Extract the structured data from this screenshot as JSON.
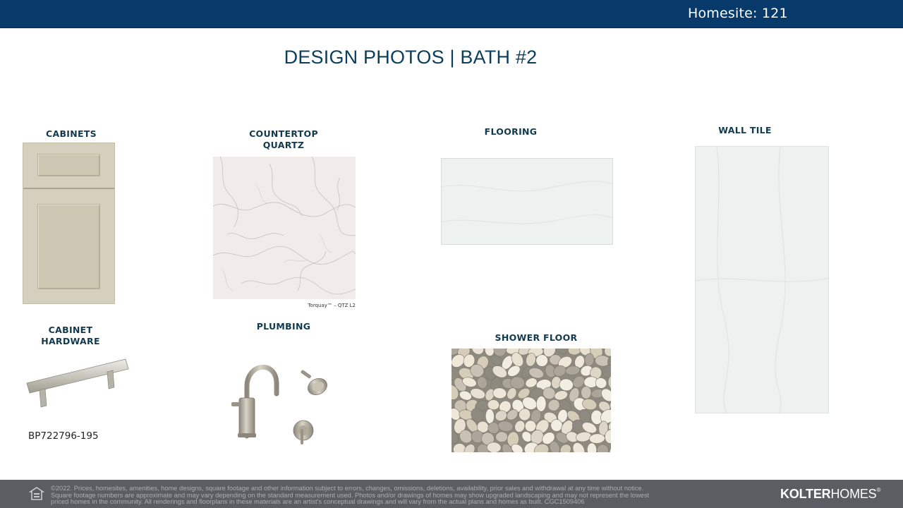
{
  "header": {
    "homesite": "Homesite: 121",
    "background": "#073a6b"
  },
  "title": "DESIGN PHOTOS | BATH #2",
  "sections": {
    "cabinets": {
      "label": "CABINETS",
      "color": "#d4d0bd"
    },
    "countertop": {
      "label_line1": "COUNTERTOP",
      "label_line2": "QUARTZ",
      "caption": "Torquay™ – QTZ L2",
      "color": "#f1ecea"
    },
    "flooring": {
      "label": "FLOORING",
      "color": "#edf1ef"
    },
    "wall_tile": {
      "label": "WALL TILE",
      "color": "#eef1ef"
    },
    "cabinet_hardware": {
      "label_line1": "CABINET",
      "label_line2": "HARDWARE",
      "sku": "BP722796-195"
    },
    "plumbing": {
      "label": "PLUMBING",
      "finish_color": "#b3ab9c"
    },
    "shower_floor": {
      "label": "SHOWER FLOOR"
    }
  },
  "footer": {
    "icon": "equal-housing-icon",
    "legal_line1": "©2022. Prices, homesites, amenities, home designs, square footage and other information subject to errors, changes, omissions, deletions, availability, prior sales and withdrawal at any time without notice.",
    "legal_line2": "Square footage numbers are approximate and may vary depending on the standard measurement used. Photos and/or drawings of homes may show upgraded landscaping and may not represent the lowest",
    "legal_line3": "priced homes in the community. All renderings and floorplans in these materials are an artist's conceptual drawings and will vary from the actual plans and homes as built. CGC1509406",
    "logo_bold": "KOLTER",
    "logo_light": "HOMES",
    "logo_mark": "®",
    "background": "#5a5e63"
  }
}
